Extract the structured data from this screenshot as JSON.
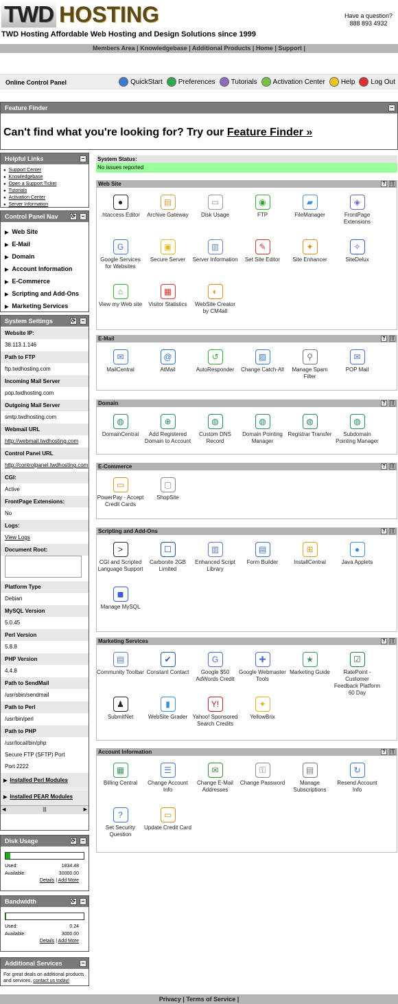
{
  "header": {
    "logo_a": "TWD",
    "logo_b": "HOSTING",
    "tagline": "TWD Hosting Affordable Web Hosting and Design Solutions since 1999",
    "question": "Have a question?",
    "phone": "888 893 4932"
  },
  "topnav": [
    "Members Area",
    "Knowledgebase",
    "Additional Products",
    "Home",
    "Support"
  ],
  "control_bar": {
    "title": "Online Control Panel",
    "links": [
      {
        "label": "QuickStart",
        "color": "#3a7bd5"
      },
      {
        "label": "Preferences",
        "color": "#2fa84f"
      },
      {
        "label": "Tutorials",
        "color": "#8a6bbd"
      },
      {
        "label": "Activation Center",
        "color": "#7ac043"
      },
      {
        "label": "Help",
        "color": "#f0c419"
      },
      {
        "label": "Log Out",
        "color": "#d9302c"
      }
    ]
  },
  "feature_finder": {
    "title": "Feature Finder",
    "message": "Can't find what you're looking for? Try our",
    "link": "Feature Finder »"
  },
  "helpful_links": {
    "title": "Helpful Links",
    "items": [
      "Support Center",
      "Knowledgebase",
      "Open a Support Ticket",
      "Tutorials",
      "Activation Center",
      "Server Information"
    ]
  },
  "cp_nav": {
    "title": "Control Panel Nav",
    "items": [
      "Web Site",
      "E-Mail",
      "Domain",
      "Account Information",
      "E-Commerce",
      "Scripting and Add-Ons",
      "Marketing Services"
    ]
  },
  "system_settings": {
    "title": "System Settings",
    "rows": [
      {
        "label": "Website IP:",
        "value": "38.113.1.146"
      },
      {
        "label": "Path to FTP",
        "value": "ftp.twdhosting.com"
      },
      {
        "label": "Incoming Mail Server",
        "value": "pop.twdhosting.com"
      },
      {
        "label": "Outgoing Mail Server",
        "value": "smtp.twdhosting.com"
      },
      {
        "label": "Webmail URL",
        "value": "http://webmail.twdhosting.com"
      },
      {
        "label": "Control Panel URL",
        "value": "http://controlpanel.twdhosting.com"
      },
      {
        "label": "CGI:",
        "value": "Active"
      },
      {
        "label": "FrontPage Extensions:",
        "value": "No"
      },
      {
        "label": "Logs:",
        "value": "View Logs"
      }
    ],
    "docroot_label": "Document Root:",
    "rows2": [
      {
        "label": "Platform Type",
        "value": "Debian"
      },
      {
        "label": "MySQL Version",
        "value": "5.0.45"
      },
      {
        "label": "Perl Version",
        "value": "5.8.8"
      },
      {
        "label": "PHP Version",
        "value": "4.4.8"
      },
      {
        "label": "Path to SendMail",
        "value": "/usr/sbin/sendmail"
      },
      {
        "label": "Path to Perl",
        "value": "/usr/bin/perl"
      },
      {
        "label": "Path to PHP",
        "value": "/usr/local/bin/php"
      }
    ],
    "sftp_label": "Secure FTP (SFTP) Port",
    "sftp_value": "Port 2222",
    "perl_modules": "Installed Perl Modules",
    "pear_modules": "Installed PEAR Modules"
  },
  "disk_usage": {
    "title": "Disk Usage",
    "used_label": "Used:",
    "used": "1834.48",
    "available_label": "Available:",
    "available": "30000.00",
    "fraction": 0.061,
    "details": "Details",
    "add_more": "Add More"
  },
  "bandwidth": {
    "title": "Bandwidth",
    "used_label": "Used:",
    "used": "0.24",
    "available_label": "Available:",
    "available": "3000.00",
    "fraction": 0.0001,
    "details": "Details",
    "add_more": "Add More"
  },
  "additional_services": {
    "title": "Additional Services",
    "text": "For great deals on additional products and services,",
    "link": "contact us today!"
  },
  "system_status": {
    "label": "System Status:",
    "value": "No issues reported"
  },
  "sections": [
    {
      "title": "Web Site",
      "items": [
        {
          "label": ".htaccess Editor",
          "icon": "bomb-icon",
          "glyph": "●",
          "color": "#222"
        },
        {
          "label": "Archive Gateway",
          "icon": "archive-icon",
          "glyph": "▤",
          "color": "#c9a24a"
        },
        {
          "label": "Disk Usage",
          "icon": "disk-icon",
          "glyph": "▭",
          "color": "#999"
        },
        {
          "label": "FTP",
          "icon": "ftp-globe-icon",
          "glyph": "◉",
          "color": "#3a3"
        },
        {
          "label": "FileManager",
          "icon": "folder-icon",
          "glyph": "▰",
          "color": "#4a8fd9"
        },
        {
          "label": "FrontPage Extensions",
          "icon": "frontpage-icon",
          "glyph": "◈",
          "color": "#7a5cc0"
        },
        {
          "label": "Google Services for Websites",
          "icon": "google-icon",
          "glyph": "G",
          "color": "#4a6fd9"
        },
        {
          "label": "Secure Server",
          "icon": "lock-icon",
          "glyph": "▣",
          "color": "#e5b81a"
        },
        {
          "label": "Server Information",
          "icon": "server-icon",
          "glyph": "▥",
          "color": "#6a88c2"
        },
        {
          "label": "Set Site Editor",
          "icon": "editor-icon",
          "glyph": "✎",
          "color": "#c33"
        },
        {
          "label": "Site Enhancer",
          "icon": "wand-icon",
          "glyph": "✦",
          "color": "#e08a1a"
        },
        {
          "label": "SiteDelux",
          "icon": "sitedelux-icon",
          "glyph": "✧",
          "color": "#3a5cc0"
        },
        {
          "label": "View my Web site",
          "icon": "home-icon",
          "glyph": "⌂",
          "color": "#3a3"
        },
        {
          "label": "Visitor Statistics",
          "icon": "stats-icon",
          "glyph": "▦",
          "color": "#d33"
        },
        {
          "label": "WebSite Creator by CM4all",
          "icon": "palette-icon",
          "glyph": "◐",
          "color": "#e08a1a"
        }
      ]
    },
    {
      "title": "E-Mail",
      "items": [
        {
          "label": "MailCentral",
          "icon": "mail-icon",
          "glyph": "✉",
          "color": "#4a6fd9"
        },
        {
          "label": "AtMail",
          "icon": "at-icon",
          "glyph": "@",
          "color": "#2a6fd9"
        },
        {
          "label": "AutoResponder",
          "icon": "autoresponder-icon",
          "glyph": "↺",
          "color": "#3a3"
        },
        {
          "label": "Change Catch-All",
          "icon": "catchall-icon",
          "glyph": "▨",
          "color": "#3a7bd5"
        },
        {
          "label": "Manage Spam Filter",
          "icon": "spam-filter-icon",
          "glyph": "⚲",
          "color": "#777"
        },
        {
          "label": "POP Mail",
          "icon": "pop-mail-icon",
          "glyph": "✉",
          "color": "#4a6fd9"
        }
      ]
    },
    {
      "title": "Domain",
      "items": [
        {
          "label": "DomainCentral",
          "icon": "domain-globe-icon",
          "glyph": "◍",
          "color": "#2a8a6a"
        },
        {
          "label": "Add Registered Domain to Account",
          "icon": "add-domain-icon",
          "glyph": "⊕",
          "color": "#2a8a6a"
        },
        {
          "label": "Custom DNS Record",
          "icon": "dns-icon",
          "glyph": "◍",
          "color": "#2a8a6a"
        },
        {
          "label": "Domain Pointing Manager",
          "icon": "pointing-icon",
          "glyph": "◍",
          "color": "#2a8a6a"
        },
        {
          "label": "Registrar Transfer",
          "icon": "transfer-icon",
          "glyph": "◍",
          "color": "#2a8a6a"
        },
        {
          "label": "Subdomain Pointing Manager",
          "icon": "subdomain-icon",
          "glyph": "◍",
          "color": "#2a8a6a"
        }
      ]
    },
    {
      "title": "E-Commerce",
      "items": [
        {
          "label": "PowerPay - Accept Credit Cards",
          "icon": "credit-card-icon",
          "glyph": "▭",
          "color": "#e08a1a"
        },
        {
          "label": "ShopSite",
          "icon": "shopsite-icon",
          "glyph": "▢",
          "color": "#888"
        }
      ]
    },
    {
      "title": "Scripting and Add-Ons",
      "items": [
        {
          "label": "CGI and Scripted Language Support",
          "icon": "terminal-icon",
          "glyph": ">",
          "color": "#222"
        },
        {
          "label": "Carbonite 2GB Limited",
          "icon": "carbonite-icon",
          "glyph": "☐",
          "color": "#1a4fa0"
        },
        {
          "label": "Enhanced Script Library",
          "icon": "library-icon",
          "glyph": "▥",
          "color": "#5a7ac0"
        },
        {
          "label": "Form Builder",
          "icon": "form-icon",
          "glyph": "▤",
          "color": "#3a6fd9"
        },
        {
          "label": "InstallCentral",
          "icon": "install-icon",
          "glyph": "⊞",
          "color": "#e0a01a"
        },
        {
          "label": "Java Applets",
          "icon": "java-icon",
          "glyph": "●",
          "color": "#3a8ae0"
        },
        {
          "label": "Manage MySQL",
          "icon": "database-icon",
          "glyph": "◼",
          "color": "#3a5cd9"
        }
      ]
    },
    {
      "title": "Marketing Services",
      "items": [
        {
          "label": "Community Toolbar",
          "icon": "toolbar-icon",
          "glyph": "▤",
          "color": "#5a7ac0"
        },
        {
          "label": "Constant Contact",
          "icon": "constant-contact-icon",
          "glyph": "✔",
          "color": "#2a5aa0"
        },
        {
          "label": "Google $50 AdWords Credit",
          "icon": "google-adwords-icon",
          "glyph": "G",
          "color": "#4a6fd9"
        },
        {
          "label": "Google Webmaster Tools",
          "icon": "webmaster-icon",
          "glyph": "✚",
          "color": "#4a6fd9"
        },
        {
          "label": "Marketing Guide",
          "icon": "marketing-icon",
          "glyph": "★",
          "color": "#3a9a5a"
        },
        {
          "label": "RatePoint - Customer Feedback Platform 60 Day",
          "icon": "ratepoint-icon",
          "glyph": "☑",
          "color": "#2a7a3a"
        },
        {
          "label": "SubmitNet",
          "icon": "penguin-icon",
          "glyph": "♟",
          "color": "#222"
        },
        {
          "label": "WebSite Grader",
          "icon": "grader-icon",
          "glyph": "▮",
          "color": "#3a8ae0"
        },
        {
          "label": "Yahoo! Sponsored Search Credits",
          "icon": "yahoo-icon",
          "glyph": "Y!",
          "color": "#c02020"
        },
        {
          "label": "YellowBrix",
          "icon": "yellowbrix-icon",
          "glyph": "✦",
          "color": "#e0b01a"
        }
      ]
    },
    {
      "title": "Account Information",
      "items": [
        {
          "label": "Billing Central",
          "icon": "billing-icon",
          "glyph": "▦",
          "color": "#3a9a5a"
        },
        {
          "label": "Change Account Info",
          "icon": "account-info-icon",
          "glyph": "☰",
          "color": "#4a6fd9"
        },
        {
          "label": "Change E-Mail Addresses",
          "icon": "change-email-icon",
          "glyph": "✉",
          "color": "#3a8a3a"
        },
        {
          "label": "Change Password",
          "icon": "keys-icon",
          "glyph": "⚿",
          "color": "#888"
        },
        {
          "label": "Manage Subscriptions",
          "icon": "subscriptions-icon",
          "glyph": "▤",
          "color": "#777"
        },
        {
          "label": "Resend Account Info",
          "icon": "resend-icon",
          "glyph": "↻",
          "color": "#3a6fd9"
        },
        {
          "label": "Set Security Question",
          "icon": "security-question-icon",
          "glyph": "?",
          "color": "#3a6fd9"
        },
        {
          "label": "Update Credit Card",
          "icon": "update-card-icon",
          "glyph": "▭",
          "color": "#e08a1a"
        }
      ]
    }
  ],
  "footer": [
    "Privacy",
    "Terms of Service"
  ]
}
